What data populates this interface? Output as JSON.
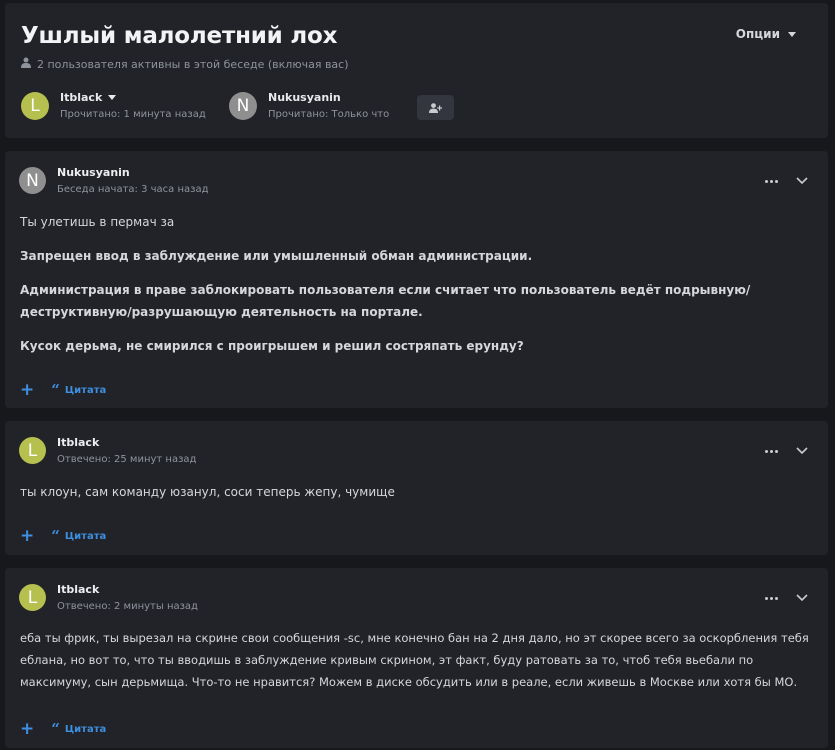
{
  "header": {
    "title": "Ушлый малолетний лох",
    "active_text": "2 пользователя активны в этой беседе (включая вас)",
    "options_label": "Опции"
  },
  "participants": [
    {
      "initial": "L",
      "name": "Itblack",
      "seen": "Прочитано: 1 минута назад",
      "avatar_color": "#b5c04f"
    },
    {
      "initial": "N",
      "name": "Nukusyanin",
      "seen": "Прочитано: Только что",
      "avatar_color": "#8f8f8f"
    }
  ],
  "messages": [
    {
      "initial": "N",
      "author": "Nukusyanin",
      "time": "Беседа начата: 3 часа назад",
      "paragraphs": [
        "Ты улетишь в пермач за",
        "Запрещен ввод в заблуждение или умышленный обман администрации.",
        "Администрация в праве заблокировать пользователя если считает что пользователь ведёт подрывную/деструктивную/разрушающую деятельность на портале.",
        "Кусок дерьма, не смирился с проигрышем и решил состряпать ерунду?"
      ],
      "quote_label": "Цитата"
    },
    {
      "initial": "L",
      "author": "Itblack",
      "time": "Отвечено: 25 минут назад",
      "paragraphs": [
        "ты клоун, сам команду юзанул, соси теперь жепу, чумище"
      ],
      "quote_label": "Цитата"
    },
    {
      "initial": "L",
      "author": "Itblack",
      "time": "Отвечено: 2 минуты назад",
      "paragraphs": [
        "еба ты фрик, ты вырезал на скрине свои сообщения -sc, мне конечно бан на 2 дня дало, но эт скорее всего за оскорбления тебя еблана, но вот то, что ты вводишь в заблуждение кривым скрином, эт факт, буду ратовать за то, чтоб тебя вьебали по максимуму, сын дерьмища. Что-то не нравится? Можем в диске обсудить или в реале, если живешь в Москве или хотя бы МО."
      ],
      "quote_label": "Цитата"
    }
  ],
  "icons": {
    "user": "user-icon",
    "add_user": "add-user-icon",
    "more": "more-dots-icon",
    "collapse": "chevron-down-icon",
    "add": "plus-icon",
    "quote": "quote-icon"
  },
  "colors": {
    "background": "#17181c",
    "panel": "#212329",
    "accent": "#3d8fe0"
  }
}
